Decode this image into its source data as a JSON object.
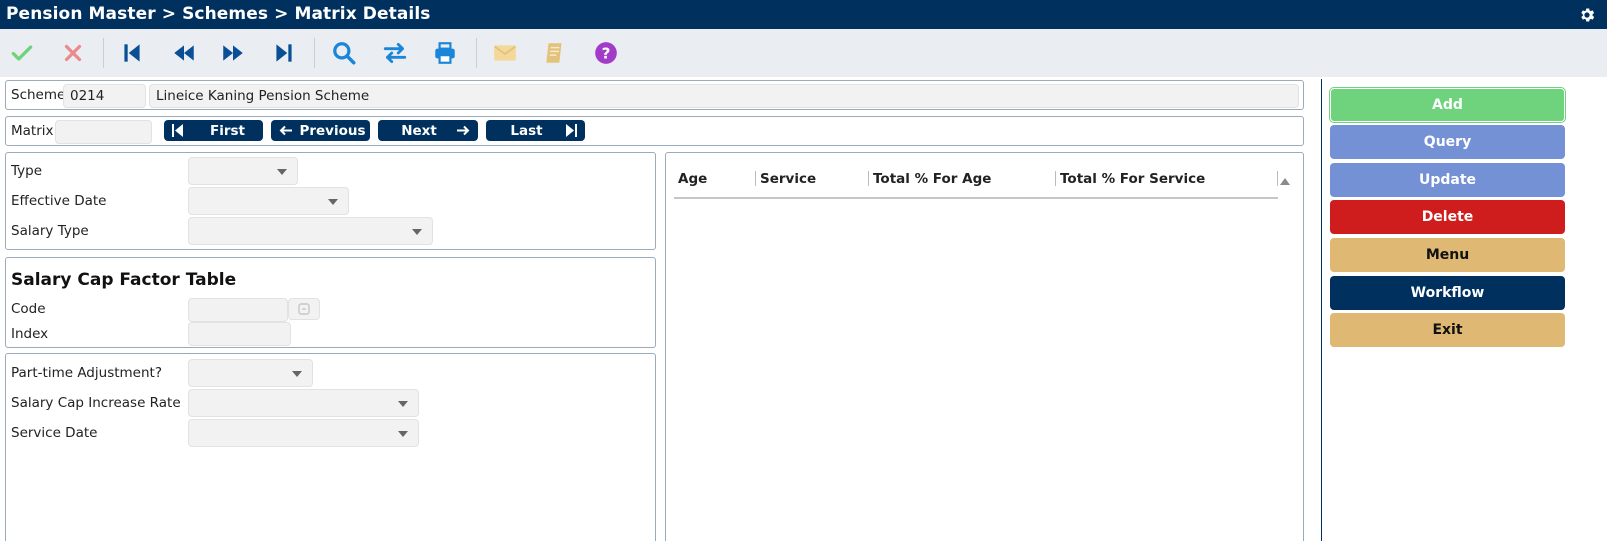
{
  "titlebar": {
    "title": "Pension Master > Schemes > Matrix Details",
    "settings_icon": "gear-icon"
  },
  "toolbar": {
    "icons": [
      "check-icon",
      "cancel-icon",
      "first-record-icon",
      "previous-record-icon",
      "next-record-icon",
      "last-record-icon",
      "search-icon",
      "swap-icon",
      "print-icon",
      "mail-icon",
      "notes-icon",
      "help-icon"
    ],
    "colors": {
      "check": "#6fd27c",
      "cancel": "#ea8a8a",
      "nav": "#0a4f95",
      "tool": "#1a86d9",
      "muted": "#e3c27a",
      "help": "#a33bc9"
    }
  },
  "scheme": {
    "label": "Scheme",
    "code": "0214",
    "name": "Lineice Kaning Pension Scheme"
  },
  "matrix": {
    "label": "Matrix",
    "value": "",
    "nav": {
      "first": "First",
      "previous": "Previous",
      "next": "Next",
      "last": "Last"
    }
  },
  "details": {
    "type_label": "Type",
    "effective_date_label": "Effective Date",
    "salary_type_label": "Salary Type"
  },
  "salary_cap": {
    "title": "Salary Cap Factor Table",
    "code_label": "Code",
    "index_label": "Index"
  },
  "adjustments": {
    "part_time_label": "Part-time Adjustment?",
    "increase_rate_label": "Salary Cap Increase Rate",
    "service_date_label": "Service Date"
  },
  "grid": {
    "columns": [
      "Age",
      "Service",
      "Total % For Age",
      "Total % For Service"
    ],
    "rows": []
  },
  "actions": [
    {
      "label": "Add",
      "bg": "#6fd27c",
      "fg": "#ffffff"
    },
    {
      "label": "Query",
      "bg": "#7591d6",
      "fg": "#ffffff"
    },
    {
      "label": "Update",
      "bg": "#7591d6",
      "fg": "#ffffff"
    },
    {
      "label": "Delete",
      "bg": "#cf1d1d",
      "fg": "#ffffff"
    },
    {
      "label": "Menu",
      "bg": "#dfb873",
      "fg": "#111111"
    },
    {
      "label": "Workflow",
      "bg": "#00305e",
      "fg": "#ffffff"
    },
    {
      "label": "Exit",
      "bg": "#dfb873",
      "fg": "#111111"
    }
  ]
}
